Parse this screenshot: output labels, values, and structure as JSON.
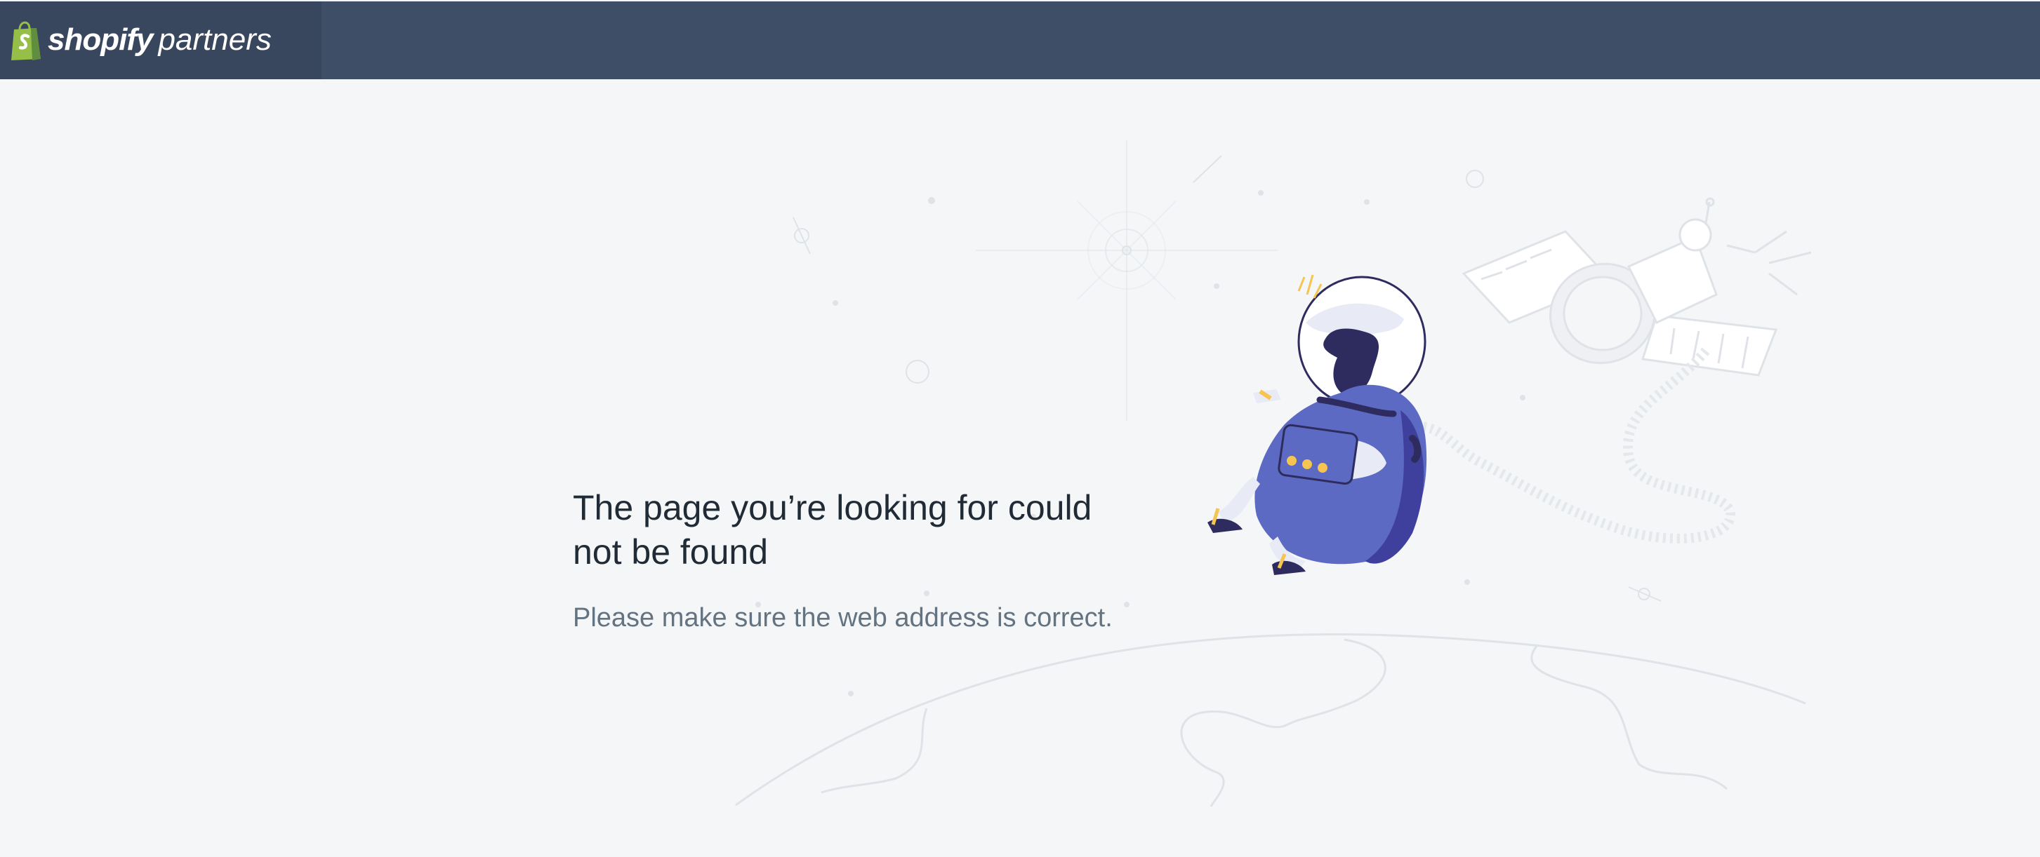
{
  "app": {
    "brand_bold": "shopify",
    "brand_light": "partners"
  },
  "error": {
    "heading": "The page you’re looking for could not be found",
    "message": "Please make sure the web address is correct."
  },
  "icons": [
    "shopify-bag-icon",
    "astronaut-illustration",
    "satellite-illustration",
    "planet-horizon-illustration"
  ],
  "colors": {
    "topbar": "#3f4e67",
    "logo_panel": "#38465e",
    "page_background": "#f4f6f8",
    "heading_text": "#212b36",
    "subtext": "#637381",
    "brand_green": "#95bf47",
    "astronaut_purple": "#5c6ac4"
  }
}
